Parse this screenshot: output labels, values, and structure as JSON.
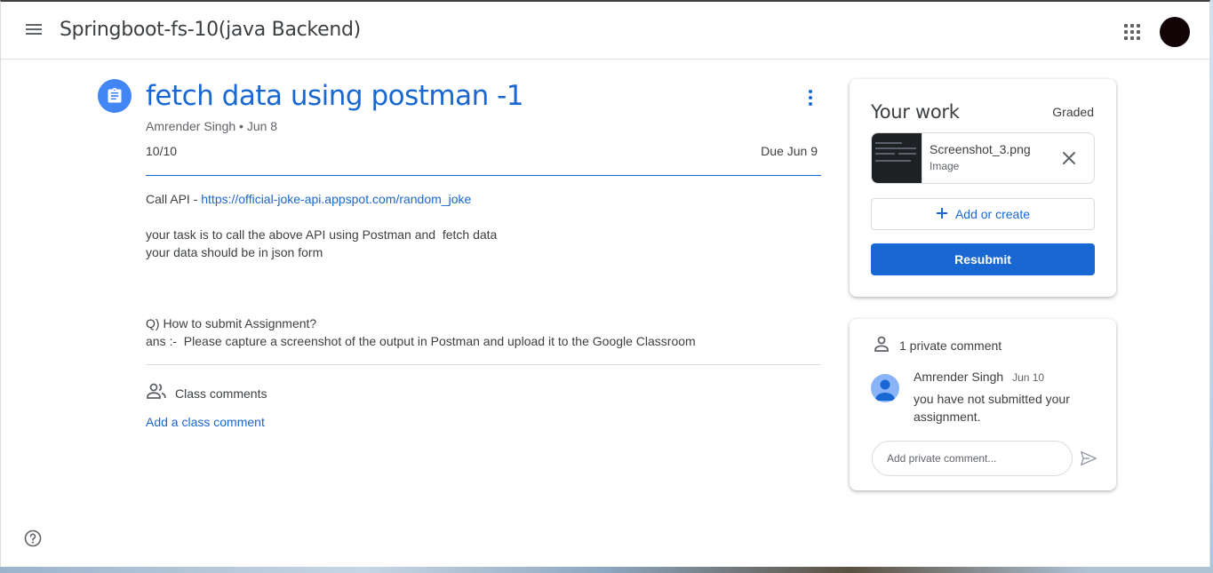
{
  "header": {
    "class_name": "Springboot-fs-10(java Backend)"
  },
  "assignment": {
    "title": "fetch data using postman -1",
    "meta": "Amrender Singh • Jun 8",
    "points": "10/10",
    "due": "Due Jun 9",
    "description": {
      "api_label": "Call API - ",
      "api_link": "https://official-joke-api.appspot.com/random_joke",
      "line1": "your task is to call the above API using Postman and  fetch data",
      "line2": "your data should be in json form",
      "question": "Q) How to submit Assignment?",
      "answer": "ans :-  Please capture a screenshot of the output in Postman and upload it to the Google Classroom"
    },
    "class_comments_label": "Class comments",
    "add_class_comment": "Add a class comment"
  },
  "your_work": {
    "title": "Your work",
    "status": "Graded",
    "attachment": {
      "name": "Screenshot_3.png",
      "type": "Image"
    },
    "add_or_create": "Add or create",
    "resubmit": "Resubmit"
  },
  "private_comments": {
    "header": "1 private comment",
    "comments": [
      {
        "author": "Amrender Singh",
        "date": "Jun 10",
        "text": "you have not submitted your assignment."
      }
    ],
    "input_placeholder": "Add private comment..."
  },
  "icons": {
    "menu": "hamburger-menu-icon",
    "apps": "google-apps-icon",
    "assignment": "assignment-icon",
    "more": "more-vert-icon",
    "people": "people-icon",
    "person": "person-icon",
    "close": "close-icon",
    "add": "plus-icon",
    "send": "send-icon",
    "help": "help-icon"
  },
  "colors": {
    "accent": "#1967d2",
    "assignment_icon_bg": "#4285f4",
    "avatar": "#120406"
  }
}
